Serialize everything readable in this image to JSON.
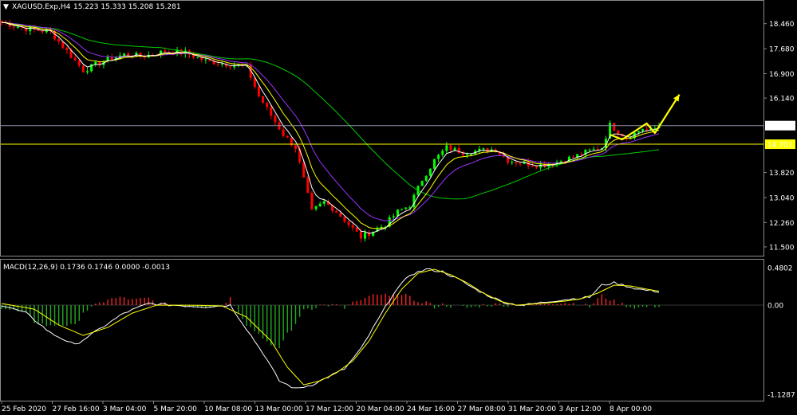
{
  "chart_data": [
    {
      "type": "candlestick",
      "title": "XAGUSD.Exp,H4",
      "ohlc_text": "15.223 15.333 15.208 15.281",
      "menu_glyph": "▼",
      "price_levels": [
        "18.460",
        "17.680",
        "16.900",
        "16.140",
        "15.281",
        "14.701",
        "13.820",
        "13.040",
        "12.260",
        "11.500"
      ],
      "ylim": [
        11.3,
        18.8
      ],
      "current_price": {
        "label": "15.281",
        "value": 15.281
      },
      "support_line": {
        "label": "14.701",
        "value": 14.701,
        "color": "#ffff00"
      },
      "x_labels": [
        "25 Feb 2020",
        "27 Feb 16:00",
        "3 Mar 04:00",
        "5 Mar 20:00",
        "10 Mar 08:00",
        "13 Mar 00:00",
        "17 Mar 12:00",
        "20 Mar 04:00",
        "24 Mar 16:00",
        "27 Mar 08:00",
        "31 Mar 20:00",
        "3 Apr 12:00",
        "8 Apr 00:00"
      ],
      "price_path": [
        [
          0,
          18.5
        ],
        [
          6,
          18.3
        ],
        [
          12,
          18.2
        ],
        [
          16,
          17.6
        ],
        [
          20,
          17.0
        ],
        [
          25,
          17.3
        ],
        [
          30,
          17.5
        ],
        [
          35,
          17.45
        ],
        [
          40,
          17.6
        ],
        [
          45,
          17.55
        ],
        [
          50,
          17.3
        ],
        [
          55,
          17.2
        ],
        [
          60,
          17.1
        ],
        [
          63,
          16.2
        ],
        [
          66,
          15.6
        ],
        [
          69,
          15.0
        ],
        [
          72,
          14.6
        ],
        [
          74,
          13.6
        ],
        [
          76,
          12.6
        ],
        [
          79,
          12.9
        ],
        [
          82,
          12.6
        ],
        [
          85,
          12.2
        ],
        [
          88,
          11.8
        ],
        [
          91,
          12.0
        ],
        [
          94,
          12.2
        ],
        [
          97,
          12.6
        ],
        [
          100,
          12.8
        ],
        [
          103,
          13.6
        ],
        [
          106,
          14.2
        ],
        [
          109,
          14.6
        ],
        [
          113,
          14.45
        ],
        [
          117,
          14.5
        ],
        [
          121,
          14.55
        ],
        [
          124,
          14.2
        ],
        [
          128,
          14.1
        ],
        [
          132,
          14.05
        ],
        [
          136,
          14.15
        ],
        [
          140,
          14.3
        ],
        [
          144,
          14.5
        ],
        [
          147,
          14.6
        ],
        [
          149,
          15.3
        ],
        [
          151,
          15.1
        ],
        [
          153,
          14.9
        ],
        [
          155,
          15.05
        ],
        [
          157,
          15.2
        ],
        [
          159,
          15.1
        ],
        [
          161,
          15.281
        ]
      ],
      "ma_fast_color": "#ffffff",
      "ma_mid_color": "#ffff00",
      "ma_slow_color": "#9933ff",
      "ma_long_color": "#00cc00",
      "up_color": "#00ff00",
      "down_color": "#ff0000",
      "forecast_arrow_color": "#ffff00",
      "forecast_path": [
        [
          149,
          15.0
        ],
        [
          152,
          14.85
        ],
        [
          155,
          15.1
        ],
        [
          158,
          15.35
        ],
        [
          160,
          15.05
        ],
        [
          166,
          16.25
        ]
      ]
    },
    {
      "type": "macd",
      "title": "MACD(12,26,9) 0.1736 0.1746 0.0000 -0.0013",
      "levels": [
        "0.4802",
        "0.00",
        "-1.1287"
      ],
      "ylim": [
        -1.1287,
        0.4802
      ],
      "macd_path": [
        [
          0,
          0.0
        ],
        [
          6,
          -0.1
        ],
        [
          12,
          -0.35
        ],
        [
          18,
          -0.5
        ],
        [
          24,
          -0.3
        ],
        [
          30,
          -0.1
        ],
        [
          36,
          0.02
        ],
        [
          42,
          0.0
        ],
        [
          50,
          -0.02
        ],
        [
          56,
          0.0
        ],
        [
          60,
          -0.3
        ],
        [
          64,
          -0.6
        ],
        [
          68,
          -0.95
        ],
        [
          72,
          -1.05
        ],
        [
          76,
          -1.0
        ],
        [
          80,
          -0.9
        ],
        [
          84,
          -0.8
        ],
        [
          88,
          -0.55
        ],
        [
          92,
          -0.2
        ],
        [
          96,
          0.15
        ],
        [
          100,
          0.38
        ],
        [
          104,
          0.45
        ],
        [
          108,
          0.42
        ],
        [
          112,
          0.32
        ],
        [
          116,
          0.2
        ],
        [
          120,
          0.1
        ],
        [
          124,
          0.02
        ],
        [
          128,
          0.0
        ],
        [
          132,
          0.03
        ],
        [
          136,
          0.06
        ],
        [
          140,
          0.08
        ],
        [
          144,
          0.1
        ],
        [
          147,
          0.25
        ],
        [
          150,
          0.28
        ],
        [
          153,
          0.24
        ],
        [
          156,
          0.2
        ],
        [
          159,
          0.18
        ],
        [
          161,
          0.17
        ]
      ],
      "signal_path": [
        [
          0,
          0.02
        ],
        [
          8,
          -0.05
        ],
        [
          14,
          -0.25
        ],
        [
          20,
          -0.38
        ],
        [
          26,
          -0.28
        ],
        [
          32,
          -0.1
        ],
        [
          38,
          0.0
        ],
        [
          46,
          0.0
        ],
        [
          54,
          -0.01
        ],
        [
          60,
          -0.15
        ],
        [
          66,
          -0.45
        ],
        [
          70,
          -0.78
        ],
        [
          74,
          -1.0
        ],
        [
          78,
          -0.95
        ],
        [
          82,
          -0.85
        ],
        [
          86,
          -0.7
        ],
        [
          90,
          -0.45
        ],
        [
          94,
          -0.1
        ],
        [
          98,
          0.2
        ],
        [
          102,
          0.4
        ],
        [
          106,
          0.45
        ],
        [
          110,
          0.38
        ],
        [
          114,
          0.28
        ],
        [
          118,
          0.15
        ],
        [
          122,
          0.05
        ],
        [
          126,
          0.0
        ],
        [
          132,
          0.02
        ],
        [
          138,
          0.05
        ],
        [
          142,
          0.08
        ],
        [
          146,
          0.15
        ],
        [
          150,
          0.25
        ],
        [
          154,
          0.24
        ],
        [
          158,
          0.2
        ],
        [
          161,
          0.175
        ]
      ],
      "macd_color": "#ffffff",
      "signal_color": "#ffff00",
      "hist_up_color": "#ff2222",
      "hist_down_color": "#22aa22"
    }
  ]
}
